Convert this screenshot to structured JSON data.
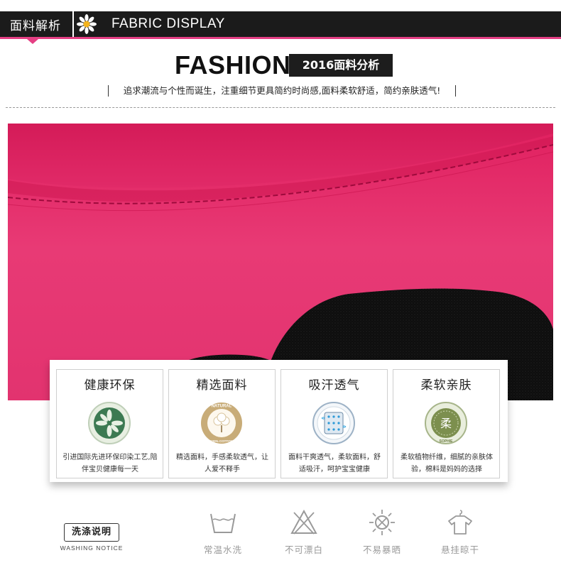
{
  "header": {
    "title_cn": "面料解析",
    "title_en": "FABRIC DISPLAY",
    "accent": "#e53f84"
  },
  "hero": {
    "headline": "FASHION",
    "tag": "2016面料分析",
    "slogan": "追求潮流与个性而诞生，注重细节更具简约时尚感,面料柔软舒适，简约亲肤透气!"
  },
  "features": [
    {
      "title": "健康环保",
      "icon": "leaf-icon",
      "desc": "引进国际先进环保印染工艺,陪伴宝贝健康每一天"
    },
    {
      "title": "精选面料",
      "icon": "cotton-icon",
      "badge_top": "NATURAL",
      "badge_bottom": "100% COTTON",
      "desc": "精选面料，手感柔软透气，让人爱不释手"
    },
    {
      "title": "吸汗透气",
      "icon": "breathable-fabric-icon",
      "desc": "面料干爽透气，柔软面料，舒适吸汗，呵护宝宝健康"
    },
    {
      "title": "柔软亲肤",
      "icon": "soft-icon",
      "badge_char": "柔",
      "badge_bottom": "SOPHIE",
      "desc": "柔软植物纤维，细腻的亲肤体验，棉料是妈妈的选择"
    }
  ],
  "washing": {
    "label_cn": "洗涤说明",
    "label_en": "WASHING NOTICE",
    "items": [
      {
        "icon": "wash-tub-icon",
        "label": "常温水洗"
      },
      {
        "icon": "no-bleach-icon",
        "label": "不可漂白"
      },
      {
        "icon": "no-sun-icon",
        "label": "不易暴晒"
      },
      {
        "icon": "hang-dry-icon",
        "label": "悬挂晾干"
      }
    ]
  },
  "colors": {
    "fabric": "#e2336f",
    "felt": "#111111",
    "dark": "#1b1b1b"
  }
}
